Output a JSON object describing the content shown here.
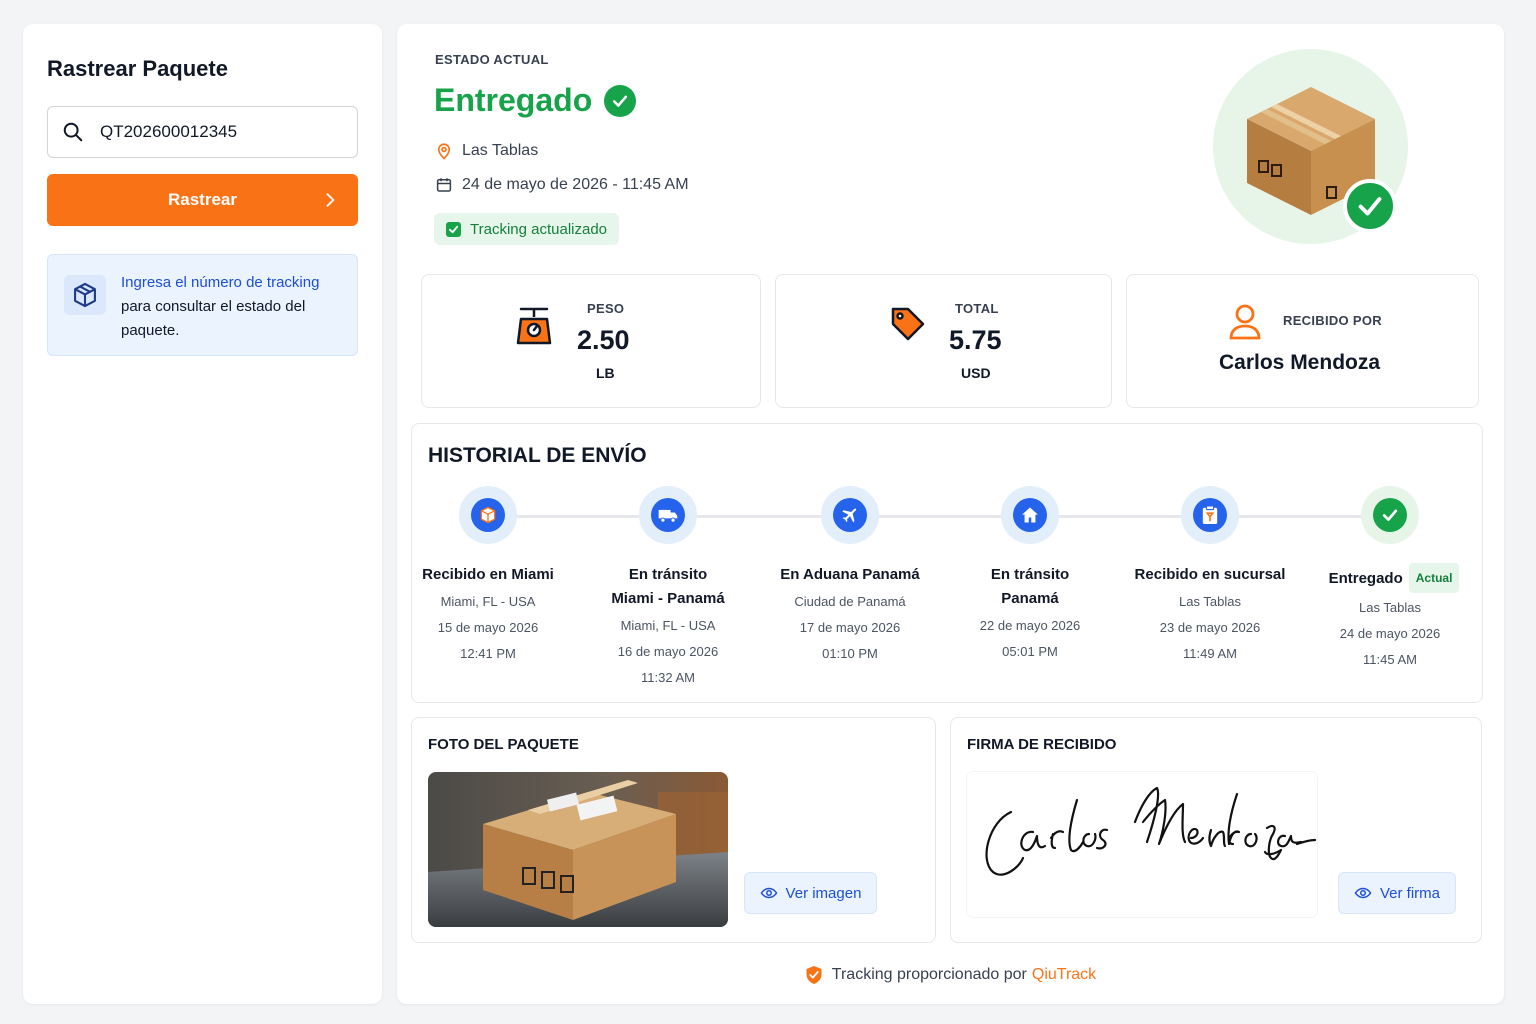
{
  "sidebar": {
    "title": "Rastrear Paquete",
    "search_value": "QT202600012345",
    "track_label": "Rastrear",
    "info_link": "Ingresa el número de tracking",
    "info_text": "para consultar el estado del paquete."
  },
  "status": {
    "eyebrow": "ESTADO ACTUAL",
    "value": "Entregado",
    "location": "Las Tablas",
    "datetime": "24 de mayo de 2026 - 11:45 AM",
    "pill": "Tracking actualizado"
  },
  "stats": {
    "peso_label": "PESO",
    "peso_value": "2.50",
    "peso_unit": "LB",
    "total_label": "TOTAL",
    "total_value": "5.75",
    "total_unit": "USD",
    "recibido_label": "RECIBIDO POR",
    "recibido_value": "Carlos Mendoza"
  },
  "history": {
    "title": "HISTORIAL DE ENVÍO",
    "current_tag": "Actual",
    "steps": [
      {
        "icon": "box-icon",
        "name": "Recibido en Miami",
        "lines": [
          "Miami, FL - USA",
          "15 de mayo 2026",
          "12:41 PM"
        ]
      },
      {
        "icon": "truck-icon",
        "name": "En tránsito",
        "name2": "Miami - Panamá",
        "lines": [
          "Miami, FL - USA",
          "16 de mayo 2026",
          "11:32 AM"
        ]
      },
      {
        "icon": "plane-icon",
        "name": "En Aduana Panamá",
        "lines": [
          "Ciudad de Panamá",
          "17 de mayo 2026",
          "01:10 PM"
        ]
      },
      {
        "icon": "home-icon",
        "name": "En tránsito",
        "name2": "Panamá",
        "lines": [
          "22 de mayo 2026",
          "05:01 PM"
        ]
      },
      {
        "icon": "clipboard-icon",
        "name": "Recibido en sucursal",
        "lines": [
          "Las Tablas",
          "23 de mayo 2026",
          "11:49 AM"
        ]
      },
      {
        "icon": "check-icon",
        "name": "Entregado",
        "lines": [
          "Las Tablas",
          "24 de mayo 2026",
          "11:45 AM"
        ]
      }
    ]
  },
  "photo": {
    "title": "FOTO DEL PAQUETE",
    "button": "Ver imagen"
  },
  "signature": {
    "title": "FIRMA DE RECIBIDO",
    "text": "Carlos Mendoza",
    "button": "Ver firma"
  },
  "footer": {
    "text": "Tracking proporcionado por",
    "brand": "QiuTrack"
  },
  "colors": {
    "accent": "#f97316",
    "success": "#16a34a",
    "primary": "#2563eb"
  }
}
